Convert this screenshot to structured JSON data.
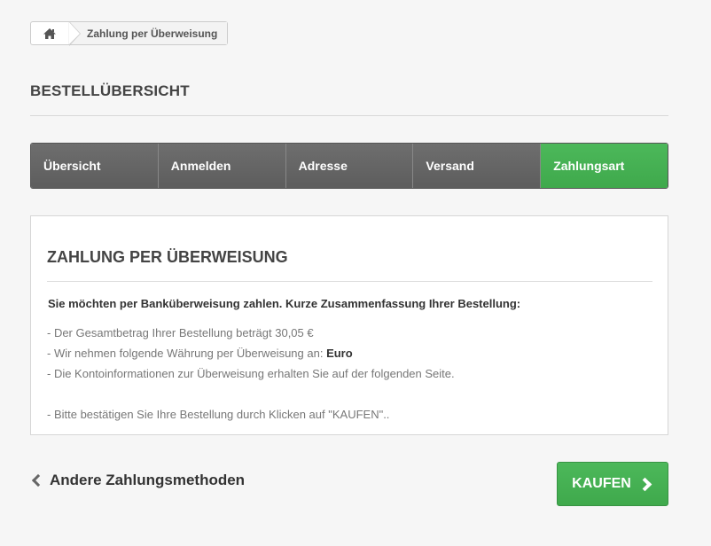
{
  "breadcrumb": {
    "home_icon": "home-icon",
    "current": "Zahlung per Überweisung"
  },
  "page": {
    "title": "BESTELLÜBERSICHT"
  },
  "steps": [
    {
      "label": "Übersicht",
      "active": false
    },
    {
      "label": "Anmelden",
      "active": false
    },
    {
      "label": "Adresse",
      "active": false
    },
    {
      "label": "Versand",
      "active": false
    },
    {
      "label": "Zahlungsart",
      "active": true
    }
  ],
  "panel": {
    "title": "ZAHLUNG PER ÜBERWEISUNG",
    "summary_heading": "Sie möchten per Banküberweisung zahlen. Kurze Zusammenfassung Ihrer Bestellung:",
    "line_total": "- Der Gesamtbetrag Ihrer Bestellung beträgt 30,05 €",
    "line_currency_prefix": "- Wir nehmen folgende Währung per Überweisung an: ",
    "line_currency_value": "Euro",
    "line_account": "- Die Kontoinformationen zur Überweisung erhalten Sie auf der folgenden Seite.",
    "line_confirm": "- Bitte bestätigen Sie Ihre Bestellung durch Klicken auf \"KAUFEN\".."
  },
  "actions": {
    "back_label": "Andere Zahlungsmethoden",
    "buy_label": "KAUFEN"
  },
  "colors": {
    "accent_green": "#44b052",
    "step_gray": "#666666"
  }
}
